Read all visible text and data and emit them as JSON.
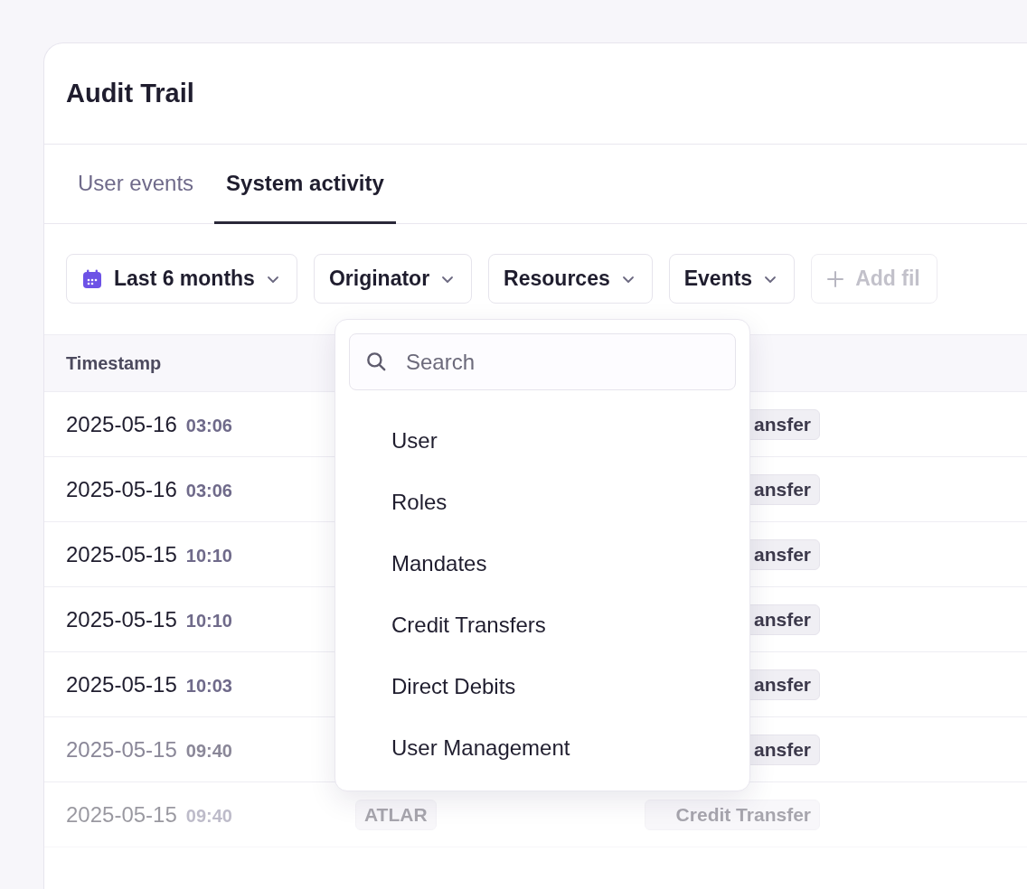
{
  "title": "Audit Trail",
  "tabs": [
    {
      "label": "User events",
      "selected": false
    },
    {
      "label": "System activity",
      "selected": true
    }
  ],
  "filters": [
    {
      "kind": "date",
      "label": "Last 6 months"
    },
    {
      "kind": "menu",
      "label": "Originator"
    },
    {
      "kind": "menu",
      "label": "Resources"
    },
    {
      "kind": "menu",
      "label": "Events"
    },
    {
      "kind": "add",
      "label": "Add fil"
    }
  ],
  "table": {
    "columns": [
      "Timestamp"
    ],
    "rows": [
      {
        "date": "2025-05-16",
        "time": "03:06",
        "resource": "ansfer"
      },
      {
        "date": "2025-05-16",
        "time": "03:06",
        "resource": "ansfer"
      },
      {
        "date": "2025-05-15",
        "time": "10:10",
        "resource": "ansfer"
      },
      {
        "date": "2025-05-15",
        "time": "10:10",
        "resource": "ansfer"
      },
      {
        "date": "2025-05-15",
        "time": "10:03",
        "resource": "ansfer"
      },
      {
        "date": "2025-05-15",
        "time": "09:40",
        "resource": "ansfer"
      },
      {
        "date": "2025-05-15",
        "time": "09:40",
        "originator": "ATLAR",
        "resource": "Credit Transfer"
      }
    ]
  },
  "dropdown": {
    "search_placeholder": "Search",
    "items": [
      "User",
      "Roles",
      "Mandates",
      "Credit Transfers",
      "Direct Debits",
      "User Management"
    ]
  }
}
